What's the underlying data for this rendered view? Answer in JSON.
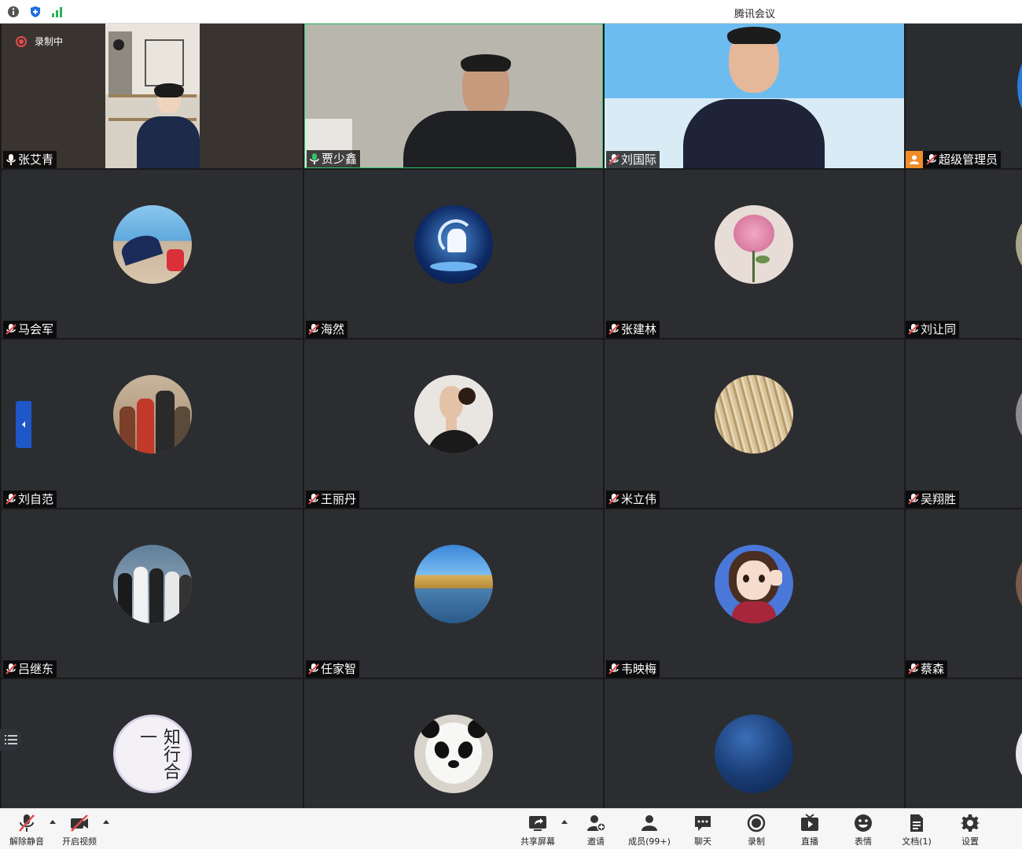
{
  "window": {
    "title": "腾讯会议",
    "status_icons": [
      "info-icon",
      "shield-icon",
      "signal-icon"
    ]
  },
  "recording": {
    "label": "录制中"
  },
  "participants": [
    {
      "name": "张艾青",
      "mic": "on",
      "type": "video"
    },
    {
      "name": "贾少鑫",
      "mic": "on",
      "type": "video",
      "speaking": true
    },
    {
      "name": "刘国际",
      "mic": "muted",
      "type": "video"
    },
    {
      "name": "超级管理员",
      "mic": "muted",
      "type": "video-partial",
      "host": true
    },
    {
      "name": "马会军",
      "mic": "muted",
      "type": "avatar",
      "avatar": "beach-umbrella"
    },
    {
      "name": "海然",
      "mic": "muted",
      "type": "avatar",
      "avatar": "unicorn-moon"
    },
    {
      "name": "张建林",
      "mic": "muted",
      "type": "avatar",
      "avatar": "pink-rose"
    },
    {
      "name": "刘让同",
      "mic": "muted",
      "type": "avatar-partial"
    },
    {
      "name": "刘自范",
      "mic": "muted",
      "type": "avatar",
      "avatar": "group-photo"
    },
    {
      "name": "王丽丹",
      "mic": "muted",
      "type": "avatar",
      "avatar": "woman-portrait"
    },
    {
      "name": "米立伟",
      "mic": "muted",
      "type": "avatar",
      "avatar": "reeds"
    },
    {
      "name": "吴翔胜",
      "mic": "muted",
      "type": "avatar-partial"
    },
    {
      "name": "吕继东",
      "mic": "muted",
      "type": "avatar",
      "avatar": "group-indoor"
    },
    {
      "name": "任家智",
      "mic": "muted",
      "type": "avatar",
      "avatar": "building-lake"
    },
    {
      "name": "韦映梅",
      "mic": "muted",
      "type": "avatar",
      "avatar": "cartoon-girl"
    },
    {
      "name": "蔡森",
      "mic": "muted",
      "type": "avatar-partial"
    },
    {
      "name": "",
      "mic": "muted",
      "type": "avatar",
      "avatar": "calligraphy"
    },
    {
      "name": "",
      "mic": "muted",
      "type": "avatar",
      "avatar": "panda"
    },
    {
      "name": "",
      "mic": "muted",
      "type": "avatar",
      "avatar": "night-sky"
    },
    {
      "name": "",
      "mic": "muted",
      "type": "avatar-partial"
    }
  ],
  "calligraphy_text": "知行合一",
  "toolbar": {
    "unmute": "解除静音",
    "start_video": "开启视频",
    "share_screen": "共享屏幕",
    "invite": "邀请",
    "members": "成员(99+)",
    "chat": "聊天",
    "record": "录制",
    "live": "直播",
    "reactions": "表情",
    "docs": "文档(1)",
    "settings": "设置"
  },
  "colors": {
    "speaking_border": "#2bc56b",
    "host_badge": "#f08c2a",
    "recording": "#e64b4b",
    "side_toggle": "#1e57c8"
  }
}
